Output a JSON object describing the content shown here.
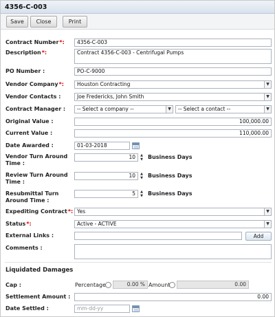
{
  "title": "4356-C-003",
  "toolbar": {
    "save": "Save",
    "close": "Close",
    "print": "Print"
  },
  "required_mark": "*:",
  "fields": {
    "contract_number": {
      "label": "Contract Number",
      "value": "4356-C-003"
    },
    "description": {
      "label": "Description",
      "value": "Contract 4356-C-003 - Centrifugal Pumps"
    },
    "po_number": {
      "label": "PO Number :",
      "value": "PO-C-9000"
    },
    "vendor_company": {
      "label": "Vendor Company",
      "value": "Houston Contracting"
    },
    "vendor_contacts": {
      "label": "Vendor Contacts :",
      "value": "Joe Fredericks, John Smith"
    },
    "contract_manager": {
      "label": "Contract Manager :",
      "company_value": "-- Select a company --",
      "contact_value": "-- Select a contact --"
    },
    "original_value": {
      "label": "Original Value :",
      "value": "100,000.00"
    },
    "current_value": {
      "label": "Current Value :",
      "value": "110,000.00"
    },
    "date_awarded": {
      "label": "Date Awarded :",
      "value": "01-03-2018"
    },
    "vendor_turn_around": {
      "label": "Vendor Turn Around Time :",
      "value": "10",
      "unit": "Business Days"
    },
    "review_turn_around": {
      "label": "Review Turn Around Time :",
      "value": "10",
      "unit": "Business Days"
    },
    "resubmittal_turn_around": {
      "label": "Resubmittal Turn Around Time :",
      "value": "5",
      "unit": "Business Days"
    },
    "expediting_contract": {
      "label": "Expediting Contract",
      "value": "Yes"
    },
    "status": {
      "label": "Status",
      "value": "Active - ACTIVE"
    },
    "external_links": {
      "label": "External Links :",
      "value": "",
      "add_label": "Add"
    },
    "comments": {
      "label": "Comments :",
      "value": ""
    }
  },
  "liquidated_damages": {
    "heading": "Liquidated Damages",
    "cap": {
      "label": "Cap :",
      "percentage_label": "Percentage",
      "percentage_value": "0.00 %",
      "amount_label": "Amount",
      "amount_value": "0.00"
    },
    "settlement_amount": {
      "label": "Settlement Amount :",
      "value": "0.00"
    },
    "date_settled": {
      "label": "Date Settled :",
      "placeholder": "mm-dd-yy"
    }
  },
  "icons": {
    "dropdown": "chevron-down-icon",
    "calendar": "calendar-icon",
    "spinner": "spinner-arrows-icon",
    "radio": "radio-icon"
  }
}
